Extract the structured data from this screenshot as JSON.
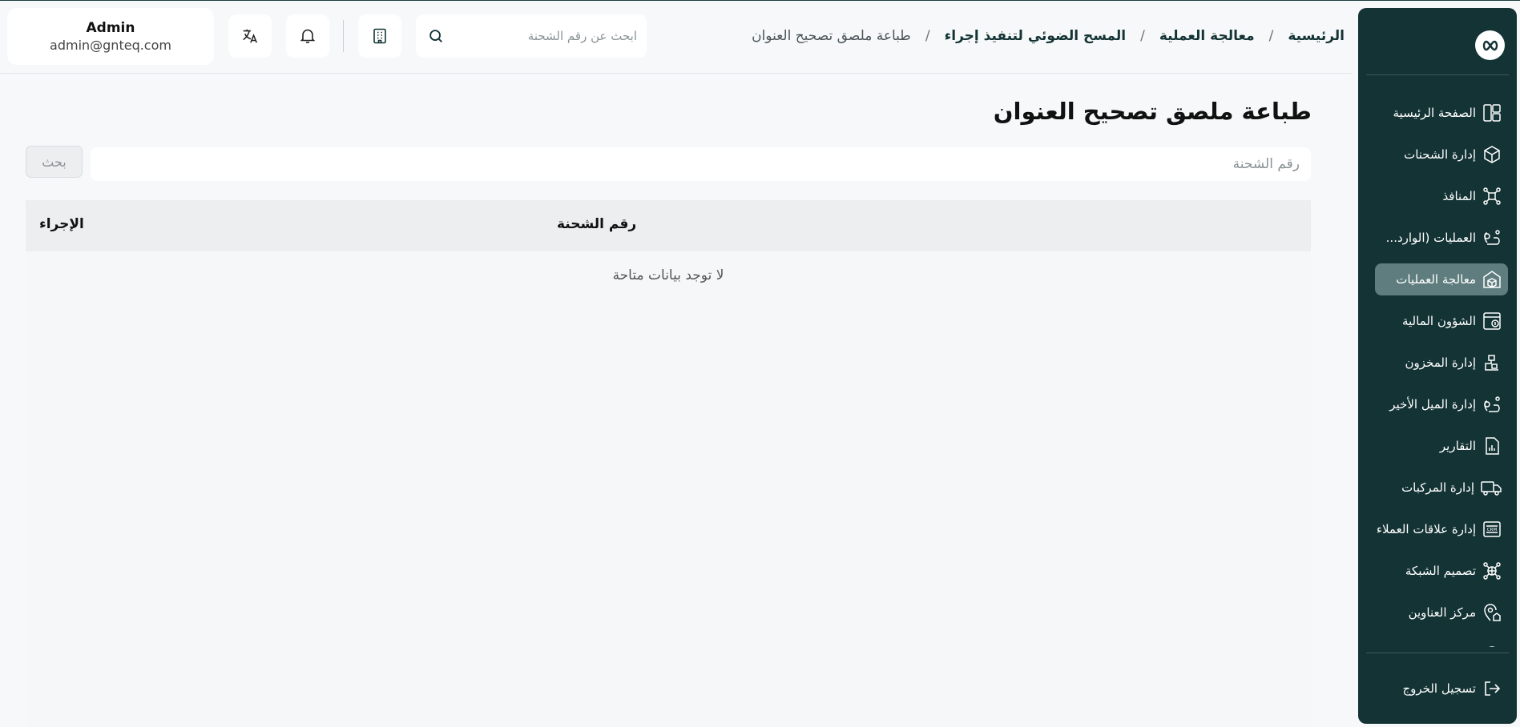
{
  "sidebar": {
    "logo_icon": "infinity-icon",
    "items": [
      {
        "label": "الصفحة الرئيسية",
        "icon": "dashboard-icon",
        "active": false
      },
      {
        "label": "إدارة الشحنات",
        "icon": "package-icon",
        "active": false
      },
      {
        "label": "المنافذ",
        "icon": "network-icon",
        "active": false
      },
      {
        "label": "العمليات (الوارد...",
        "icon": "route-icon",
        "active": false
      },
      {
        "label": "معالجة العمليات",
        "icon": "warehouse-icon",
        "active": true
      },
      {
        "label": "الشؤون المالية",
        "icon": "finance-icon",
        "active": false
      },
      {
        "label": "إدارة المخزون",
        "icon": "inventory-icon",
        "active": false
      },
      {
        "label": "إدارة الميل الأخير",
        "icon": "last-mile-icon",
        "active": false
      },
      {
        "label": "التقارير",
        "icon": "report-icon",
        "active": false
      },
      {
        "label": "إدارة المركبات",
        "icon": "truck-icon",
        "active": false
      },
      {
        "label": "إدارة علاقات العملاء",
        "icon": "crm-icon",
        "active": false
      },
      {
        "label": "تصميم الشبكة",
        "icon": "network-design-icon",
        "active": false
      },
      {
        "label": "مركز العناوين",
        "icon": "address-icon",
        "active": false
      }
    ],
    "logout_label": "تسجيل الخروج"
  },
  "header": {
    "breadcrumb": [
      "الرئيسية",
      "معالجة العملية",
      "المسح الضوئي لتنفيذ إجراء",
      "طباعة ملصق تصحيح العنوان"
    ],
    "breadcrumb_separator": "/",
    "search_placeholder": "ابحث عن رقم الشحنة",
    "user": {
      "name": "Admin",
      "email": "admin@gnteq.com"
    }
  },
  "main": {
    "title": "طباعة ملصق تصحيح العنوان",
    "shipment_placeholder": "رقم الشحنة",
    "search_button": "بحث",
    "table": {
      "columns": [
        "رقم الشحنة",
        "الإجراء"
      ],
      "empty_text": "لا توجد بيانات متاحة"
    }
  },
  "colors": {
    "sidebar_bg": "#143335",
    "active_item": "#5f7d7e",
    "page_bg": "#f6f8f9"
  }
}
